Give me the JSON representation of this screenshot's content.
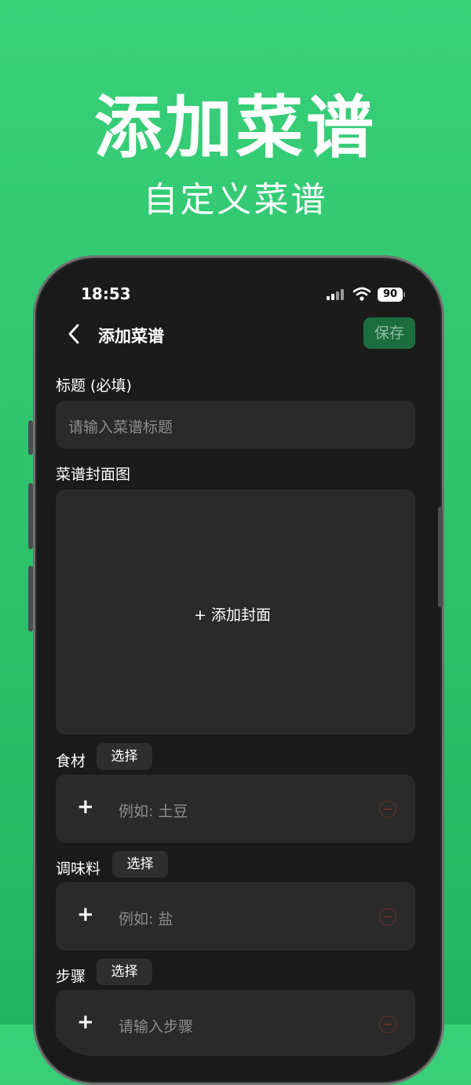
{
  "promo": {
    "title": "添加菜谱",
    "subtitle": "自定义菜谱"
  },
  "status_bar": {
    "time": "18:53",
    "battery": "90"
  },
  "nav": {
    "title": "添加菜谱",
    "save_label": "保存"
  },
  "form": {
    "title_label": "标题 (必填)",
    "title_placeholder": "请输入菜谱标题",
    "cover_label": "菜谱封面图",
    "cover_add": "+ 添加封面",
    "ingredients": {
      "label": "食材",
      "select": "选择",
      "add": "+",
      "placeholder": "例如: 土豆"
    },
    "seasonings": {
      "label": "调味料",
      "select": "选择",
      "add": "+",
      "placeholder": "例如: 盐"
    },
    "steps": {
      "label": "步骤",
      "select": "选择",
      "add": "+",
      "placeholder": "请输入步骤"
    }
  },
  "icons": {
    "back": "chevron-left-icon",
    "remove": "minus-circle-icon",
    "signal": "signal-icon",
    "wifi": "wifi-icon"
  },
  "colors": {
    "background": "#2ec46d",
    "save_button": "#1c6e3f",
    "remove_icon": "#6a2f2f"
  }
}
